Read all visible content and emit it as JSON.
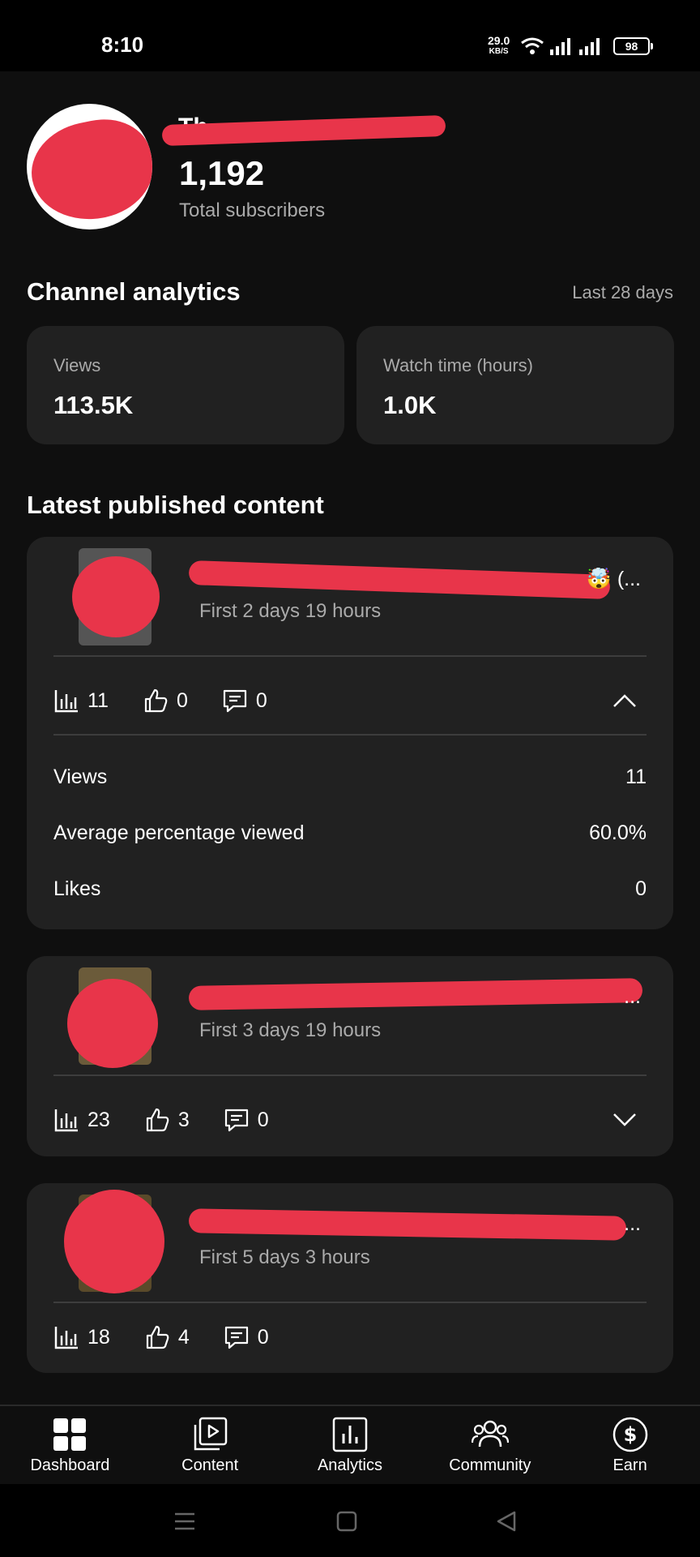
{
  "status_bar": {
    "time": "8:10",
    "net_rate": "29.0",
    "net_unit": "KB/S",
    "battery": "98"
  },
  "channel": {
    "name": "Th",
    "subscriber_count": "1,192",
    "subscriber_label": "Total subscribers"
  },
  "analytics": {
    "title": "Channel analytics",
    "period": "Last 28 days",
    "metrics": [
      {
        "label": "Views",
        "value": "113.5K"
      },
      {
        "label": "Watch time (hours)",
        "value": "1.0K"
      }
    ]
  },
  "latest": {
    "title": "Latest published content",
    "items": [
      {
        "title_visible": "🤯 (...",
        "age": "First 2 days 19 hours",
        "views": "11",
        "likes": "0",
        "comments": "0",
        "expanded": true,
        "details": [
          {
            "label": "Views",
            "value": "11"
          },
          {
            "label": "Average percentage viewed",
            "value": "60.0%"
          },
          {
            "label": "Likes",
            "value": "0"
          }
        ]
      },
      {
        "title_visible": "...",
        "age": "First 3 days 19 hours",
        "views": "23",
        "likes": "3",
        "comments": "0",
        "expanded": false
      },
      {
        "title_visible": "...",
        "age": "First 5 days 3 hours",
        "views": "18",
        "likes": "4",
        "comments": "0",
        "expanded": false
      }
    ]
  },
  "bottom_nav": {
    "items": [
      {
        "label": "Dashboard",
        "icon": "dashboard-icon"
      },
      {
        "label": "Content",
        "icon": "content-icon"
      },
      {
        "label": "Analytics",
        "icon": "analytics-icon"
      },
      {
        "label": "Community",
        "icon": "community-icon"
      },
      {
        "label": "Earn",
        "icon": "earn-icon"
      }
    ]
  },
  "colors": {
    "background": "#0f0f0f",
    "card": "#212121",
    "secondary_text": "#aaaaaa",
    "redaction": "#e8354a"
  }
}
